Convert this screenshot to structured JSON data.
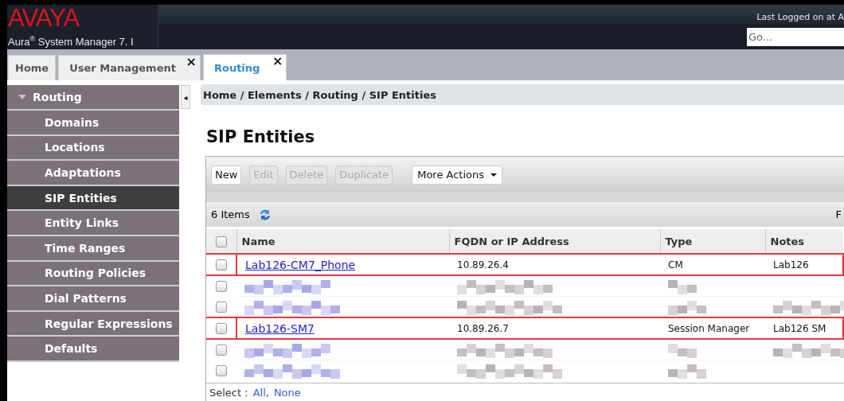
{
  "header": {
    "logo": "AVAYA",
    "product": "Aura$^{®}$ System Manager 7. I",
    "last_login": "Last Logged on at A",
    "search": {
      "placeholder": "Go..."
    }
  },
  "tabs": [
    {
      "label": "Home",
      "selected": false,
      "closable": false
    },
    {
      "label": "User Management",
      "selected": false,
      "closable": true,
      "close": "×"
    },
    {
      "label": "Routing",
      "selected": true,
      "closable": true,
      "close": "×"
    }
  ],
  "sidebar": {
    "title": "Routing",
    "expanded": true,
    "collapse": "◂",
    "items": [
      {
        "label": "Domains",
        "selected": false
      },
      {
        "label": "Locations",
        "selected": false
      },
      {
        "label": "Adaptations",
        "selected": false
      },
      {
        "label": "SIP Entities",
        "selected": true
      },
      {
        "label": "Entity Links",
        "selected": false
      },
      {
        "label": "Time Ranges",
        "selected": false
      },
      {
        "label": "Routing Policies",
        "selected": false
      },
      {
        "label": "Dial Patterns",
        "selected": false
      },
      {
        "label": "Regular Expressions",
        "selected": false
      },
      {
        "label": "Defaults",
        "selected": false
      }
    ]
  },
  "breadcrumb": "Home / Elements / Routing / SIP Entities",
  "page_title": "SIP Entities",
  "toolbar": [
    {
      "label": "New",
      "kind": "button",
      "disabled": false
    },
    {
      "label": "Edit",
      "kind": "button",
      "disabled": true
    },
    {
      "label": "Delete",
      "kind": "button",
      "disabled": true
    },
    {
      "label": "Duplicate",
      "kind": "button",
      "disabled": true
    },
    {
      "label": "More Actions",
      "kind": "dropdown",
      "disabled": false
    }
  ],
  "item_count": "6 Items",
  "filter_partial": "F",
  "table": {
    "select_all_checked": false,
    "columns": [
      "Name",
      "FQDN or IP Address",
      "Type",
      "Notes"
    ],
    "rows": [
      {
        "kind": "entity",
        "checked": false,
        "highlighted": true,
        "cells": [
          "Lab126-CM7_Phone",
          "10.89.26.4",
          "CM",
          "Lab126"
        ]
      },
      {
        "kind": "redacted",
        "checked": false,
        "highlighted": false,
        "blurred": [
          true,
          true,
          true,
          false
        ]
      },
      {
        "kind": "redacted",
        "checked": false,
        "highlighted": false,
        "blurred": [
          true,
          true,
          true,
          true
        ]
      },
      {
        "kind": "entity",
        "checked": false,
        "highlighted": true,
        "cells": [
          "Lab126-SM7",
          "10.89.26.7",
          "Session Manager",
          "Lab126 SM"
        ]
      },
      {
        "kind": "redacted",
        "checked": false,
        "highlighted": false,
        "blurred": [
          true,
          true,
          true,
          true
        ]
      },
      {
        "kind": "redacted",
        "checked": false,
        "highlighted": false,
        "blurred": [
          true,
          true,
          true,
          false
        ]
      }
    ]
  },
  "footer": {
    "label": "Select :",
    "links": [
      "All,",
      "None"
    ]
  }
}
